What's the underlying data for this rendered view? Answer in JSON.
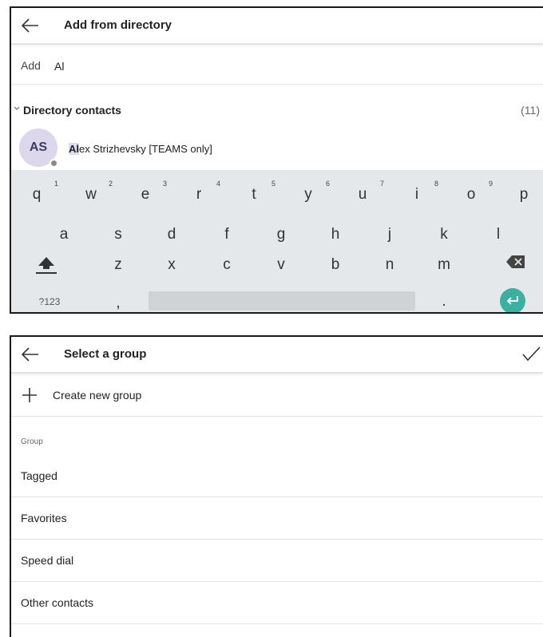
{
  "directory_screen": {
    "title": "Add from directory",
    "search": {
      "label": "Add",
      "value": "Al"
    },
    "section": {
      "title": "Directory contacts",
      "count": "(11)"
    },
    "contact": {
      "initials": "AS",
      "match": "Al",
      "rest": "ex Strizhevsky [TEAMS only]"
    },
    "keyboard": {
      "row1": [
        "q",
        "w",
        "e",
        "r",
        "t",
        "y",
        "u",
        "i",
        "o",
        "p"
      ],
      "row1_numbers": [
        "1",
        "2",
        "3",
        "4",
        "5",
        "6",
        "7",
        "8",
        "9"
      ],
      "row2": [
        "a",
        "s",
        "d",
        "f",
        "g",
        "h",
        "j",
        "k",
        "l"
      ],
      "row3": [
        "z",
        "x",
        "c",
        "v",
        "b",
        "n",
        "m"
      ],
      "symbols_key": "?123",
      "comma_key": ",",
      "period_key": ".",
      "enter_color": "#3bb0a0"
    }
  },
  "group_screen": {
    "title": "Select a group",
    "create_label": "Create new group",
    "group_header": "Group",
    "groups": [
      "Tagged",
      "Favorites",
      "Speed dial",
      "Other contacts"
    ]
  }
}
